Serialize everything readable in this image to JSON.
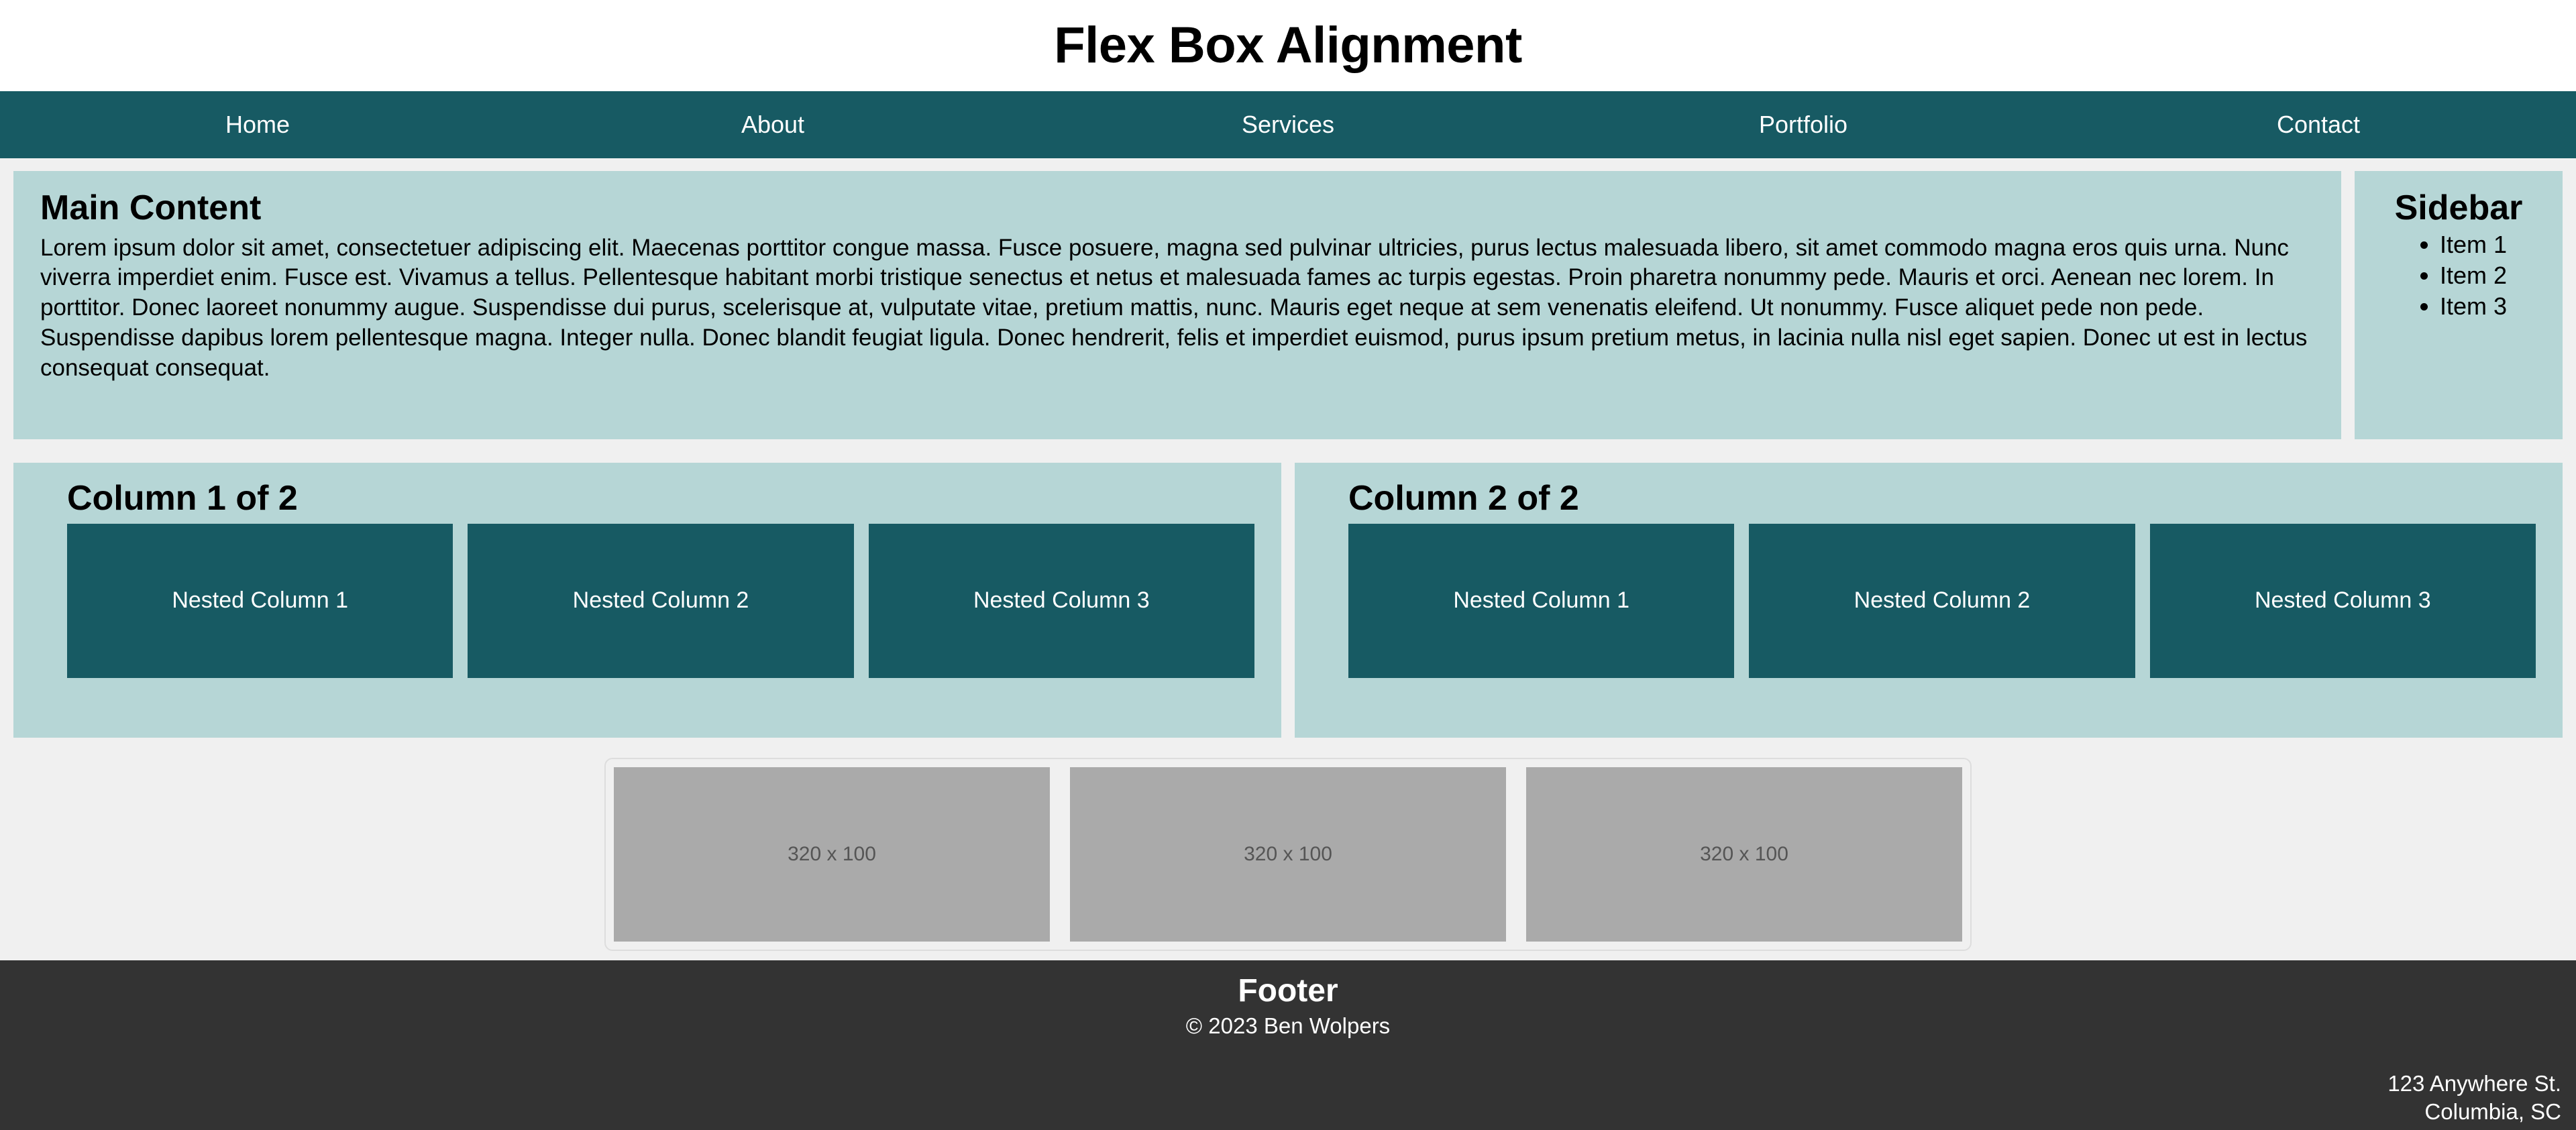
{
  "header": {
    "title": "Flex Box Alignment"
  },
  "nav": {
    "items": [
      {
        "label": "Home"
      },
      {
        "label": "About"
      },
      {
        "label": "Services"
      },
      {
        "label": "Portfolio"
      },
      {
        "label": "Contact"
      }
    ]
  },
  "main": {
    "heading": "Main Content",
    "paragraph": "Lorem ipsum dolor sit amet, consectetuer adipiscing elit. Maecenas porttitor congue massa. Fusce posuere, magna sed pulvinar ultricies, purus lectus malesuada libero, sit amet commodo magna eros quis urna. Nunc viverra imperdiet enim. Fusce est. Vivamus a tellus. Pellentesque habitant morbi tristique senectus et netus et malesuada fames ac turpis egestas. Proin pharetra nonummy pede. Mauris et orci. Aenean nec lorem. In porttitor. Donec laoreet nonummy augue. Suspendisse dui purus, scelerisque at, vulputate vitae, pretium mattis, nunc. Mauris eget neque at sem venenatis eleifend. Ut nonummy. Fusce aliquet pede non pede. Suspendisse dapibus lorem pellentesque magna. Integer nulla. Donec blandit feugiat ligula. Donec hendrerit, felis et imperdiet euismod, purus ipsum pretium metus, in lacinia nulla nisl eget sapien. Donec ut est in lectus consequat consequat."
  },
  "sidebar": {
    "heading": "Sidebar",
    "items": [
      {
        "label": "Item 1"
      },
      {
        "label": "Item 2"
      },
      {
        "label": "Item 3"
      }
    ]
  },
  "columns": [
    {
      "heading": "Column 1 of 2",
      "nested": [
        {
          "label": "Nested Column 1"
        },
        {
          "label": "Nested Column 2"
        },
        {
          "label": "Nested Column 3"
        }
      ]
    },
    {
      "heading": "Column 2 of 2",
      "nested": [
        {
          "label": "Nested Column 1"
        },
        {
          "label": "Nested Column 2"
        },
        {
          "label": "Nested Column 3"
        }
      ]
    }
  ],
  "images": [
    {
      "label": "320 x 100"
    },
    {
      "label": "320 x 100"
    },
    {
      "label": "320 x 100"
    }
  ],
  "footer": {
    "heading": "Footer",
    "copyright": "© 2023 Ben Wolpers",
    "address_line1": "123 Anywhere St.",
    "address_line2": "Columbia, SC"
  },
  "colors": {
    "accent_dark_teal": "#175a63",
    "panel_light_teal": "#b6d6d6",
    "page_background": "#f0f0f0",
    "footer_background": "#333333",
    "placeholder_gray": "#aaaaaa"
  }
}
